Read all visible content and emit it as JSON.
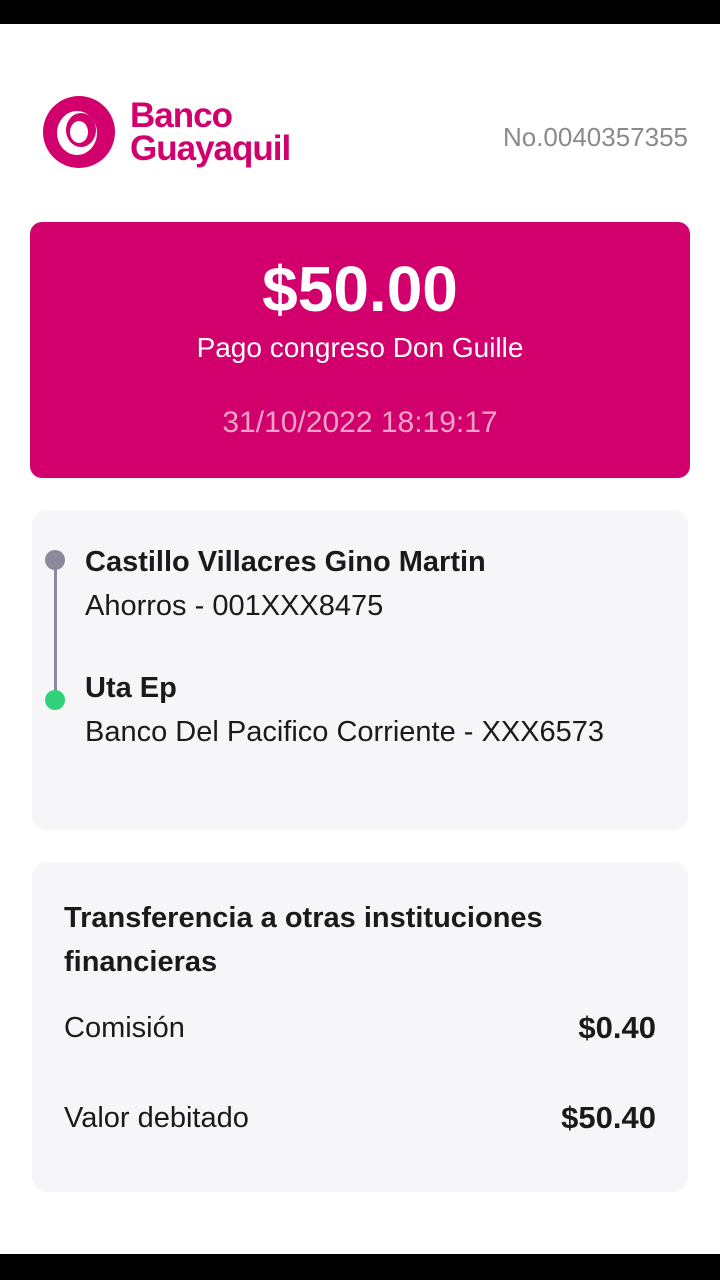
{
  "brand": {
    "line1": "Banco",
    "line2": "Guayaquil",
    "color": "#d1006d"
  },
  "receipt_number": "No.0040357355",
  "transaction": {
    "amount": "$50.00",
    "concept": "Pago congreso Don Guille",
    "datetime": "31/10/2022 18:19:17"
  },
  "origin": {
    "name": "Castillo Villacres Gino Martin",
    "account": "Ahorros - 001XXX8475"
  },
  "destination": {
    "name": "Uta Ep",
    "account": "Banco Del Pacifico Corriente - XXX6573"
  },
  "details": {
    "type": "Transferencia a otras instituciones financieras",
    "commission_label": "Comisión",
    "commission_value": "$0.40",
    "debited_label": "Valor debitado",
    "debited_value": "$50.40"
  }
}
